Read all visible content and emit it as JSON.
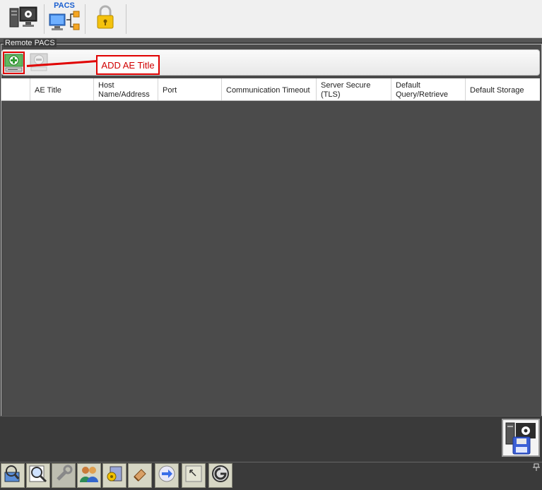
{
  "toolbar": {
    "items": [
      {
        "name": "server-settings",
        "icon": "server-gear-icon"
      },
      {
        "name": "pacs",
        "label": "PACS",
        "icon": "pacs-network-icon"
      },
      {
        "name": "lock",
        "icon": "lock-icon"
      }
    ]
  },
  "remote_pacs": {
    "group_label": "Remote PACS",
    "add_button_icon": "add-ae-title-icon",
    "remove_button_icon": "remove-ae-title-icon",
    "callout": "ADD AE Title"
  },
  "table": {
    "columns": [
      {
        "label": ""
      },
      {
        "label": "AE Title"
      },
      {
        "label": "Host Name/Address"
      },
      {
        "label": "Port"
      },
      {
        "label": "Communication Timeout"
      },
      {
        "label": "Server Secure (TLS)"
      },
      {
        "label": "Default Query/Retrieve"
      },
      {
        "label": "Default Storage"
      }
    ],
    "rows": []
  },
  "bottom": {
    "save_icon": "save-config-icon"
  },
  "taskbar": {
    "items": [
      "search-network-icon",
      "magnifier-icon",
      "tools-icon",
      "users-icon",
      "settings-box-icon",
      "eraser-icon",
      "disc-arrow-icon",
      "resize-arrow-icon",
      "power-logo-icon"
    ]
  },
  "colors": {
    "accent_red": "#e00000",
    "background_dark": "#4b4b4b",
    "pacs_label_blue": "#1a5fd0"
  }
}
